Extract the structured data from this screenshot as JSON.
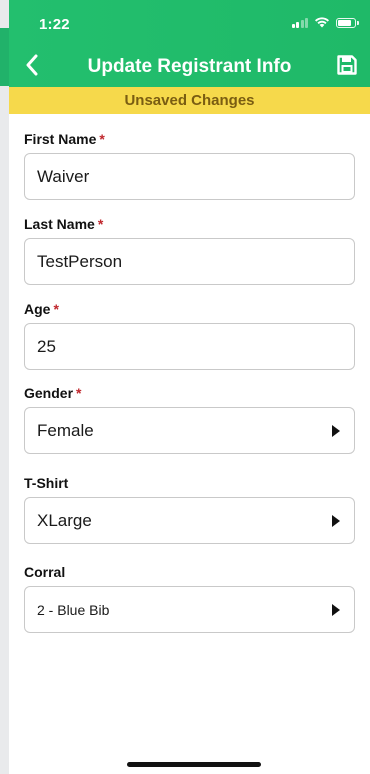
{
  "status_bar": {
    "time": "1:22"
  },
  "nav": {
    "title": "Update Registrant Info",
    "back_icon": "chevron-left-icon",
    "save_icon": "save-icon"
  },
  "banner": {
    "text": "Unsaved Changes"
  },
  "colors": {
    "header_green": "#23bf6e",
    "banner_yellow": "#f6d94b",
    "required_red": "#c0272d"
  },
  "fields": [
    {
      "label": "First Name",
      "required_mark": "*",
      "value": "Waiver",
      "type": "text"
    },
    {
      "label": "Last Name",
      "required_mark": "*",
      "value": "TestPerson",
      "type": "text"
    },
    {
      "label": "Age",
      "required_mark": "*",
      "value": "25",
      "type": "text"
    },
    {
      "label": "Gender",
      "required_mark": "*",
      "value": "Female",
      "type": "select"
    },
    {
      "label": "T-Shirt",
      "value": "XLarge",
      "type": "select"
    },
    {
      "label": "Corral",
      "value": "2 - Blue Bib",
      "type": "select"
    }
  ]
}
